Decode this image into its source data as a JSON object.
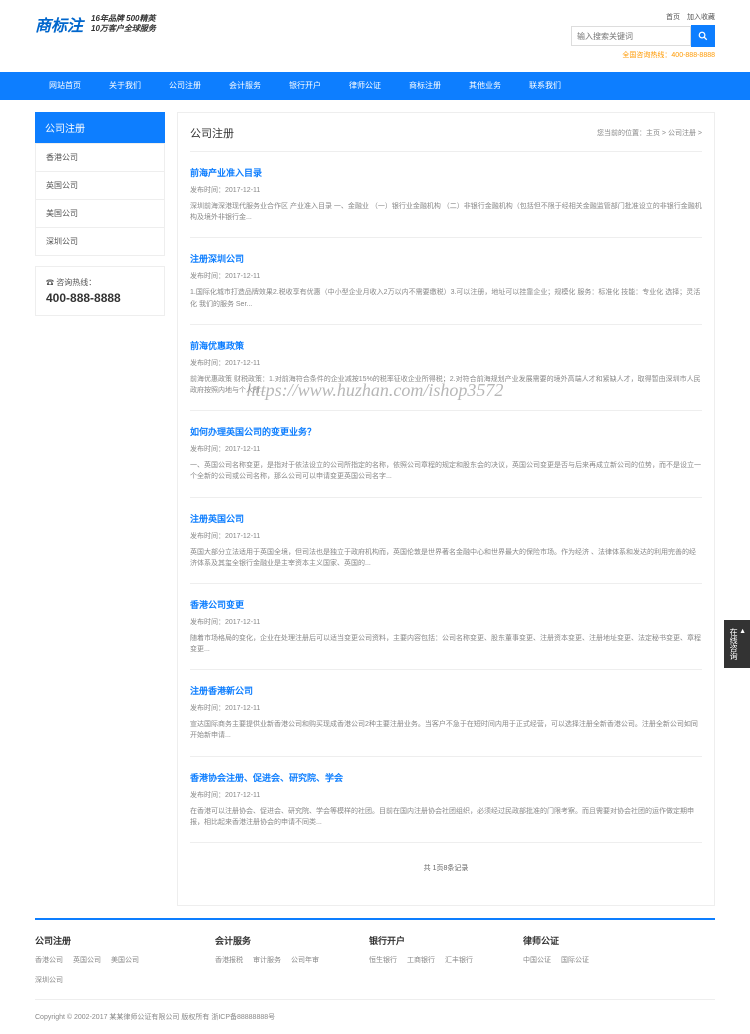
{
  "header": {
    "logo": "商标注",
    "slogan_line1": "16年品牌 500精英",
    "slogan_line2": "10万客户全球服务",
    "search_placeholder": "输入搜索关键词",
    "top_links": [
      "首页",
      "加入收藏"
    ],
    "hotline_label": "全国咨询热线：",
    "hotline_tel": "400-888-8888"
  },
  "nav": [
    "网站首页",
    "关于我们",
    "公司注册",
    "会计服务",
    "银行开户",
    "律师公证",
    "商标注册",
    "其他业务",
    "联系我们"
  ],
  "sidebar": {
    "title": "公司注册",
    "items": [
      "香港公司",
      "英国公司",
      "美国公司",
      "深圳公司"
    ],
    "contact_label": "咨询热线：",
    "contact_tel": "400-888-8888"
  },
  "content": {
    "title": "公司注册",
    "breadcrumb": "您当前的位置：主页 > 公司注册 >",
    "articles": [
      {
        "title": "前海产业准入目录",
        "date": "发布时间：2017-12-11",
        "desc": "深圳前海深港现代服务业合作区 产业准入目录 一、金融业 （一）银行业金融机构 （二）非银行金融机构（包括但不限于经相关金融监管部门批准设立的非银行金融机构及境外非银行金..."
      },
      {
        "title": "注册深圳公司",
        "date": "发布时间：2017-12-11",
        "desc": "1.国际化城市打造品牌效果2.税收享有优惠（中小型企业月收入2万以内不需要缴税）3.可以注册，地址可以挂靠企业；规模化 服务：标准化 技能：专业化 选择；灵活化 我们的服务 Ser..."
      },
      {
        "title": "前海优惠政策",
        "date": "发布时间：2017-12-11",
        "desc": "前海优惠政策 财税政策：1.对前海符合条件的企业减按15%的税率征收企业所得税；2.对符合前海规划产业发展需要的境外高端人才和紧缺人才，取得暂由深圳市人民政府按照内地与个人所..."
      },
      {
        "title": "如何办理英国公司的变更业务？",
        "date": "发布时间：2017-12-11",
        "desc": "一、英国公司名称变更，是指对于依法设立的公司所指定的名称，依照公司章程的规定和股东会的决议，英国公司变更是否与后来再成立新公司的位势，而不是设立一个全新的公司或公司名称，那么公司可以申请变更英国公司名字..."
      },
      {
        "title": "注册英国公司",
        "date": "发布时间：2017-12-11",
        "desc": "英国大部分立法适用于英国全境，但司法也是独立于政府机构而，英国伦敦是世界著名金融中心和世界最大的保险市场。作为经济 、法律体系和发达的利用完善的经济体系及其玺全银行金融业是主宰资本主义国家、英国的..."
      },
      {
        "title": "香港公司变更",
        "date": "发布时间：2017-12-11",
        "desc": "随着市场格局的变化，企业在处理注册后可以适当变更公司资料，主要内容包括：公司名称变更、股东董事变更、注册资本变更、注册地址变更、法定秘书变更、章程变更..."
      },
      {
        "title": "注册香港新公司",
        "date": "发布时间：2017-12-11",
        "desc": "宣达国际商务主要提供业新香港公司和购买现成香港公司2种主要注册业务。当客户不急于在短时间内用于正式经营，可以选择注册全新香港公司。注册全新公司如同开始新申请..."
      },
      {
        "title": "香港协会注册、促进会、研究院、学会",
        "date": "发布时间：2017-12-11",
        "desc": "在香港可以注册协会、促进会、研究院、学会等模样的社团。目前在国内注册协会社团组织，必须经过民政部批准的门限考察。而且需要对协会社团的运作做定期申报，相比起来香港注册协会的申请不同类..."
      }
    ],
    "pagination": "共 1页8条记录"
  },
  "footer": {
    "columns": [
      {
        "title": "公司注册",
        "links": [
          "香港公司",
          "英国公司",
          "美国公司",
          "深圳公司"
        ]
      },
      {
        "title": "会计服务",
        "links": [
          "香港报税",
          "审计服务",
          "公司年审"
        ]
      },
      {
        "title": "银行开户",
        "links": [
          "恒生银行",
          "工商银行",
          "汇丰银行"
        ]
      },
      {
        "title": "律师公证",
        "links": [
          "中国公证",
          "国际公证"
        ]
      }
    ],
    "copyright": "Copyright © 2002-2017 某某律师公证有限公司 版权所有 浙ICP备88888888号"
  },
  "side_float": "在线咨询",
  "watermark": "https://www.huzhan.com/ishop3572"
}
